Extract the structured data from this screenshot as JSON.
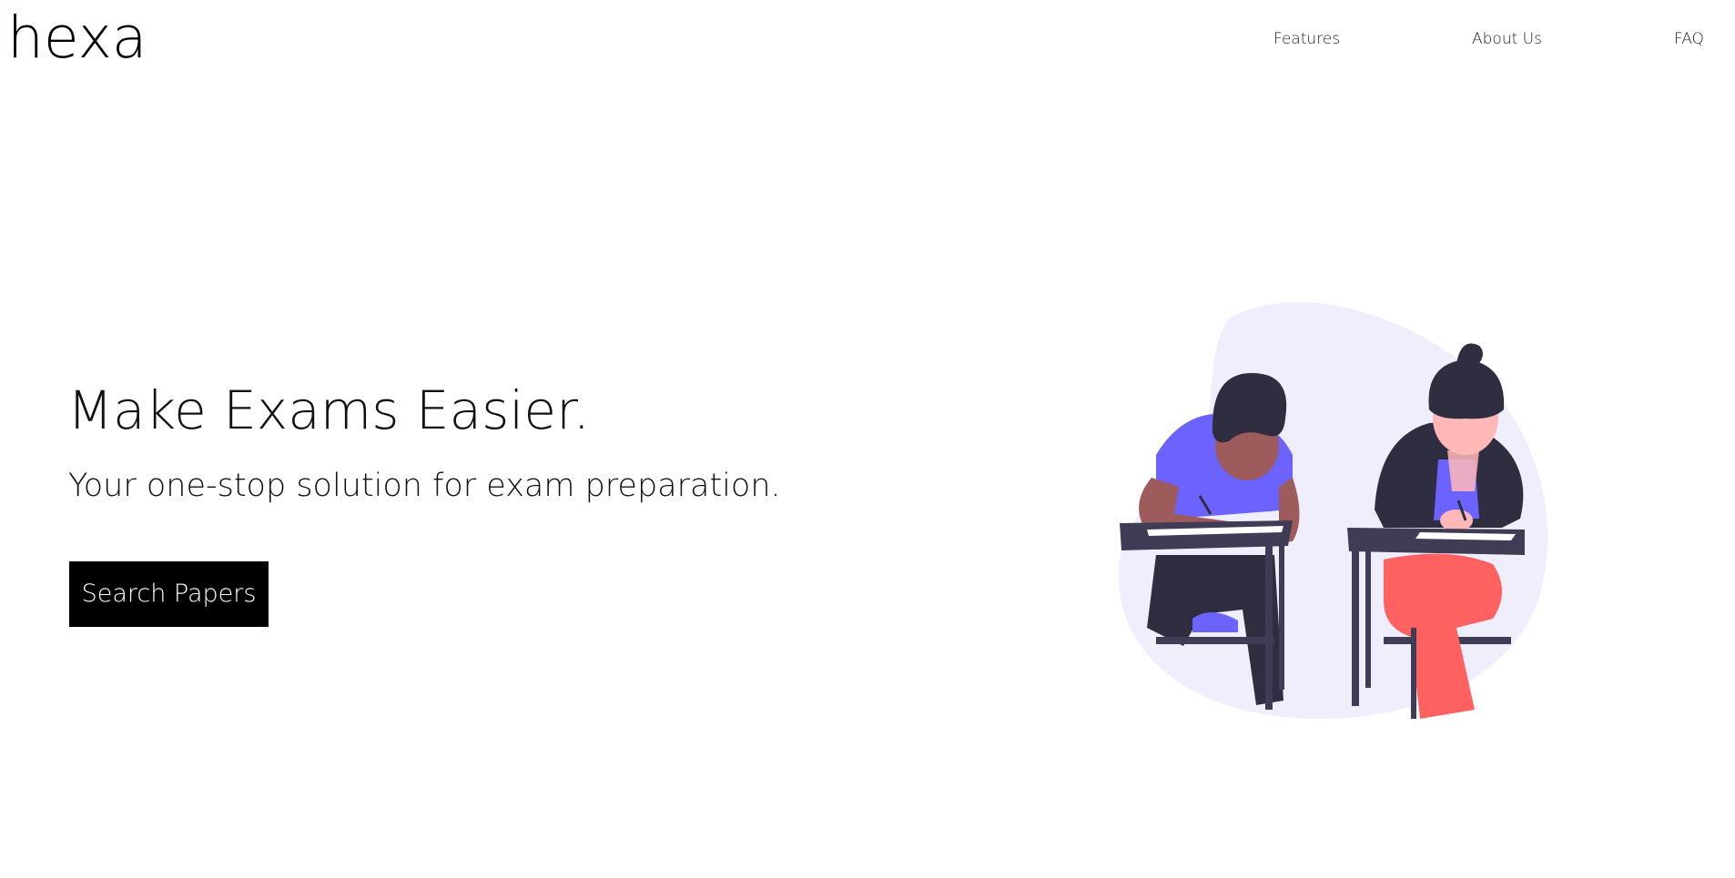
{
  "header": {
    "logo_text": "hexa",
    "nav": [
      {
        "label": "Features"
      },
      {
        "label": "About Us"
      },
      {
        "label": "FAQ"
      }
    ]
  },
  "hero": {
    "title": "Make Exams Easier.",
    "subtitle": "Your one-stop solution for exam preparation.",
    "cta_label": "Search Papers"
  },
  "illustration": {
    "subject": "two students writing exams at desks",
    "icon": "students-writing-illustration"
  },
  "colors": {
    "background": "#ffffff",
    "text": "#111111",
    "button_bg": "#000000",
    "button_text": "#ffffff",
    "blob": "#efeefc",
    "accent_purple": "#6c63ff",
    "desk_dark": "#3f3d56",
    "hair_dark": "#2f2e41",
    "skin_brown": "#9e5b5b",
    "skin_light": "#ffb8b8",
    "pants_red": "#ff6161"
  }
}
